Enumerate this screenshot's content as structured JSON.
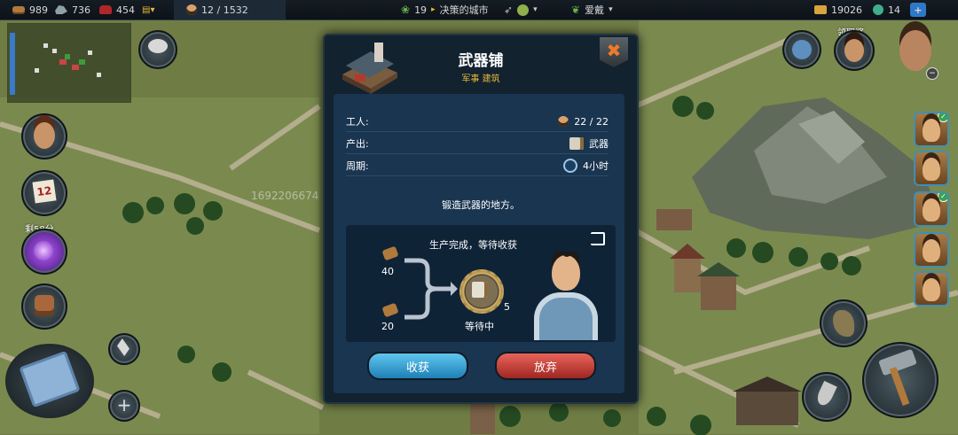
{
  "topbar": {
    "wood": "989",
    "ore": "736",
    "cloth": "454",
    "workers": "12 / 1532",
    "city_level": "19",
    "city_name": "决策的城市",
    "ruler_name": "爱戴",
    "gold": "19026",
    "gems": "14",
    "plus": "+"
  },
  "left_panel": {
    "calendar_day": "12",
    "event_label": "剩58分"
  },
  "map": {
    "stray_number": "1692206674"
  },
  "right_panel": {
    "header_label": "领取奖"
  },
  "dialog": {
    "title": "武器铺",
    "subtitle": "军事  建筑",
    "close_label": "✖",
    "stats": [
      {
        "label": "工人:",
        "value": "22 / 22",
        "icon": "worker-icon"
      },
      {
        "label": "产出:",
        "value": "武器",
        "icon": "weapons-icon"
      },
      {
        "label": "周期:",
        "value": "4小时",
        "icon": "clock-icon"
      }
    ],
    "description": "锻造武器的地方。",
    "production": {
      "status": "生产完成，等待收获",
      "input1_amount": "40",
      "input2_amount": "20",
      "output_count": "5",
      "waiting_label": "等待中"
    },
    "buttons": {
      "harvest": "收获",
      "abandon": "放弃"
    }
  },
  "colors": {
    "accent_gold": "#e6b83a",
    "harvest_blue": "#2f9fd8",
    "abandon_red": "#c6392f",
    "dialog_bg": "#12222f"
  }
}
